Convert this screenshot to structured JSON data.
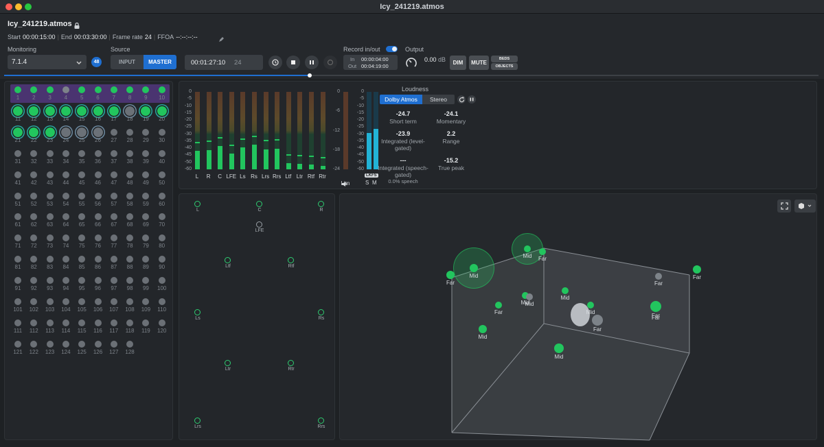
{
  "window": {
    "title": "Icy_241219.atmos"
  },
  "project": {
    "name": "Icy_241219.atmos",
    "start_label": "Start",
    "start": "00:00:15:00",
    "end_label": "End",
    "end": "00:03:30:00",
    "framerate_label": "Frame rate",
    "framerate": "24",
    "ffoa_label": "FFOA",
    "ffoa": "--:--:--:--"
  },
  "monitoring": {
    "label": "Monitoring",
    "value": "7.1.4",
    "badge": "48"
  },
  "source": {
    "label": "Source",
    "input": "INPUT",
    "master": "MASTER"
  },
  "transport": {
    "timecode": "00:01:27:10",
    "frame": "24",
    "progress": 0.375
  },
  "record": {
    "label": "Record in/out",
    "in_label": "In",
    "in": "00:00:04:00",
    "out_label": "Out",
    "out": "00:04:19:00"
  },
  "output": {
    "label": "Output",
    "level": "0.00",
    "unit": "dB",
    "dim": "DIM",
    "mute": "MUTE",
    "beds": "BEDS",
    "objects": "OBJECTS"
  },
  "channels": {
    "rows": [
      {
        "nums": [
          "1",
          "2",
          "3",
          "4",
          "5",
          "6",
          "7",
          "8",
          "9",
          "10"
        ]
      },
      {
        "nums": [
          "11",
          "12",
          "13",
          "14",
          "15",
          "16",
          "17",
          "18",
          "19",
          "20"
        ]
      },
      {
        "nums": [
          "21",
          "22",
          "23",
          "24",
          "25",
          "26",
          "27",
          "28",
          "29",
          "30"
        ]
      },
      {
        "nums": [
          "31",
          "32",
          "33",
          "34",
          "35",
          "36",
          "37",
          "38",
          "39",
          "40"
        ]
      },
      {
        "nums": [
          "41",
          "42",
          "43",
          "44",
          "45",
          "46",
          "47",
          "48",
          "49",
          "50"
        ]
      },
      {
        "nums": [
          "51",
          "52",
          "53",
          "54",
          "55",
          "56",
          "57",
          "58",
          "59",
          "60"
        ]
      },
      {
        "nums": [
          "61",
          "62",
          "63",
          "64",
          "65",
          "66",
          "67",
          "68",
          "69",
          "70"
        ]
      },
      {
        "nums": [
          "71",
          "72",
          "73",
          "74",
          "75",
          "76",
          "77",
          "78",
          "79",
          "80"
        ]
      },
      {
        "nums": [
          "81",
          "82",
          "83",
          "84",
          "85",
          "86",
          "87",
          "88",
          "89",
          "90"
        ]
      },
      {
        "nums": [
          "91",
          "92",
          "93",
          "94",
          "95",
          "96",
          "97",
          "98",
          "99",
          "100"
        ]
      },
      {
        "nums": [
          "101",
          "102",
          "103",
          "104",
          "105",
          "106",
          "107",
          "108",
          "109",
          "110"
        ]
      },
      {
        "nums": [
          "111",
          "112",
          "113",
          "114",
          "115",
          "116",
          "117",
          "118",
          "119",
          "120"
        ]
      },
      {
        "nums": [
          "121",
          "122",
          "123",
          "124",
          "125",
          "126",
          "127",
          "128"
        ]
      }
    ]
  },
  "meters": {
    "scale": [
      "0",
      "-5",
      "-10",
      "-15",
      "-20",
      "-25",
      "-30",
      "-35",
      "-40",
      "-45",
      "-50",
      "-60"
    ],
    "channels": [
      "L",
      "R",
      "C",
      "LFE",
      "Ls",
      "Rs",
      "Lrs",
      "Rrs",
      "Ltf",
      "Ltr",
      "Rtf",
      "Rtr"
    ],
    "lim_scale": [
      "0",
      "-6",
      "-12",
      "-18",
      "-24"
    ],
    "lim_label": "Lim",
    "lkfs_scale": [
      "0",
      "-5",
      "-10",
      "-15",
      "-20",
      "-25",
      "-30",
      "-35",
      "-40",
      "-45",
      "-50",
      "-60"
    ],
    "lkfs_badge": "LKFS",
    "s": "S",
    "m": "M"
  },
  "loudness": {
    "title": "Loudness",
    "tab_atmos": "Dolby Atmos",
    "tab_stereo": "Stereo",
    "short_term": "-24.7",
    "short_term_label": "Short term",
    "momentary": "-24.1",
    "momentary_label": "Momentary",
    "integrated": "-23.9",
    "integrated_label": "Integrated (level-gated)",
    "range": "2.2",
    "range_label": "Range",
    "speech": "---",
    "speech_label": "Integrated (speech-gated)",
    "speech_pct": "0.0% speech",
    "true_peak": "-15.2",
    "true_peak_label": "True peak"
  },
  "speakers": {
    "labels": [
      "L",
      "C",
      "R",
      "LFE",
      "Ltf",
      "Rtf",
      "Ls",
      "Rs",
      "Ltr",
      "Rtr",
      "Lrs",
      "Rrs"
    ]
  },
  "room": {
    "labels": [
      "Mid",
      "Far",
      "Mid",
      "Far",
      "Far",
      "Mid",
      "Far",
      "Mid",
      "Mid",
      "Far",
      "Mid",
      "Mid",
      "Far",
      "Mid",
      "Far",
      "Far"
    ]
  },
  "colors": {
    "accent": "#1f6fd1",
    "green": "#22c55e",
    "panel": "#23262a"
  }
}
